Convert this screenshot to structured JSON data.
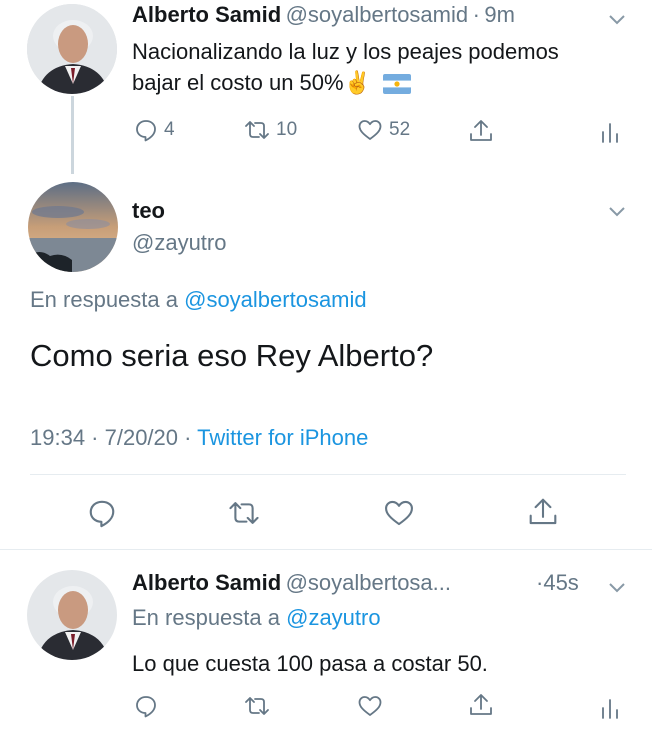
{
  "tweet1": {
    "name": "Alberto Samid",
    "handle": "@soyalbertosamid",
    "time_sep": "·",
    "time": "9m",
    "text": "Nacionalizando la luz y los peajes podemos bajar el costo un 50%✌️",
    "flag": "argentina-flag",
    "replies": "4",
    "retweets": "10",
    "likes": "52"
  },
  "tweet2": {
    "name": "teo",
    "handle": "@zayutro",
    "reply_prefix": "En respuesta a",
    "reply_to": "@soyalbertosamid",
    "text": "Como seria eso Rey Alberto?",
    "time": "19:34 · 7/20/20 ·",
    "source": "Twitter for iPhone"
  },
  "tweet3": {
    "name": "Alberto Samid",
    "handle": "@soyalbertosa...",
    "time_sep": "·",
    "time": "45s",
    "reply_prefix": "En respuesta a",
    "reply_to": "@zayutro",
    "text": "Lo que cuesta 100 pasa a costar 50."
  },
  "icons": [
    "reply-icon",
    "retweet-icon",
    "like-icon",
    "share-icon",
    "analytics-icon",
    "chevron-down-icon"
  ],
  "colors": {
    "accent": "#1b95e0",
    "muted": "#657786",
    "text": "#14171a",
    "divider": "#e6ecf0"
  }
}
